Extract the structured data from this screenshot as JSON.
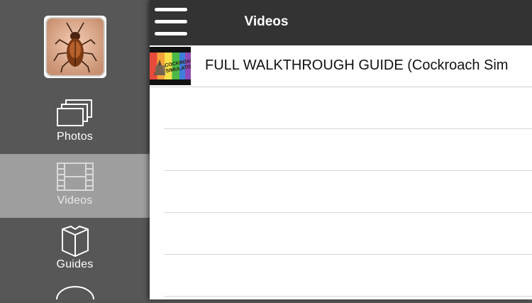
{
  "header": {
    "title": "Videos"
  },
  "sidebar": {
    "items": [
      {
        "label": "Photos",
        "icon": "photos-icon",
        "active": false
      },
      {
        "label": "Videos",
        "icon": "film-icon",
        "active": true
      },
      {
        "label": "Guides",
        "icon": "book-icon",
        "active": false
      }
    ]
  },
  "videos": {
    "items": [
      {
        "title": "FULL WALKTHROUGH GUIDE (Cockroach Sim",
        "thumbnail_text": "COCKROACH SIMULATOR"
      }
    ]
  },
  "colors": {
    "sidebar_bg": "#575757",
    "active_item_bg": "#9e9e9e",
    "navbar_bg": "#333333"
  }
}
